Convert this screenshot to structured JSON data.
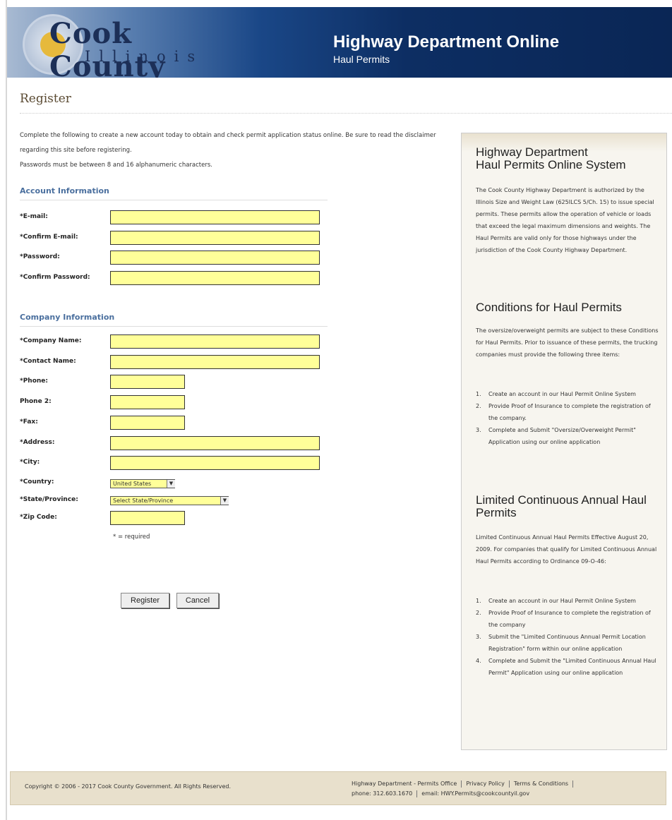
{
  "header": {
    "logo_cook": "Cook County",
    "logo_illinois": "Illinois",
    "title": "Highway Department Online",
    "subtitle": "Haul Permits"
  },
  "page": {
    "title": "Register",
    "intro_1": "Complete the following to create a new account today to obtain and check permit application status online. Be sure to read the disclaimer regarding this site before registering.",
    "intro_2": "Passwords must be between 8 and 16 alphanumeric characters."
  },
  "account": {
    "heading": "Account Information",
    "email_label": "*E-mail:",
    "confirm_email_label": "*Confirm E-mail:",
    "password_label": "*Password:",
    "confirm_password_label": "*Confirm Password:"
  },
  "company": {
    "heading": "Company Information",
    "company_name_label": "*Company Name:",
    "contact_name_label": "*Contact Name:",
    "phone_label": "*Phone:",
    "phone2_label": "Phone 2:",
    "fax_label": "*Fax:",
    "address_label": "*Address:",
    "city_label": "*City:",
    "country_label": "*Country:",
    "country_value": "United States",
    "state_label": "*State/Province:",
    "state_value": "Select State/Province",
    "zip_label": "*Zip Code:",
    "required_note": "* = required"
  },
  "buttons": {
    "register": "Register",
    "cancel": "Cancel"
  },
  "sidebar": {
    "title_line1": "Highway Department",
    "title_line2": "Haul Permits Online System",
    "intro": "The Cook County Highway Department is authorized by the Illinois Size and Weight Law (625ILCS 5/Ch. 15) to issue special permits. These permits allow the operation of vehicle or loads that exceed the legal maximum dimensions and weights. The Haul Permits are valid only for those highways under the jurisdiction of the Cook County Highway Department.",
    "conditions_heading": "Conditions for Haul Permits",
    "conditions_text": "The oversize/overweight permits are subject to these Conditions for Haul Permits. Prior to issuance of these permits, the trucking companies must provide the following three items:",
    "conditions_items": [
      "Create an account in our Haul Permit Online System",
      "Provide Proof of Insurance to complete the registration of the company.",
      "Complete and Submit \"Oversize/Overweight Permit\" Application using our online application"
    ],
    "annual_heading": "Limited Continuous Annual Haul Permits",
    "annual_text": "Limited Continuous Annual Haul Permits Effective August 20, 2009. For companies that qualify for Limited Continuous Annual Haul Permits according to Ordinance 09-O-46:",
    "annual_items": [
      "Create an account in our Haul Permit Online System",
      "Provide Proof of Insurance to complete the registration of the company",
      "Submit the \"Limited Continuous Annual Permit Location Registration\" form within our online application",
      "Complete and Submit the \"Limited Continuous Annual Haul Permit\" Application using our online application"
    ]
  },
  "footer": {
    "copyright": "Copyright © 2006 - 2017 Cook County Government. All Rights Reserved.",
    "office": "Highway Department - Permits Office",
    "privacy": "Privacy Policy",
    "terms": "Terms & Conditions",
    "phone": "phone: 312.603.1670",
    "email": "email: HWY.Permits@cookcountyil.gov"
  }
}
